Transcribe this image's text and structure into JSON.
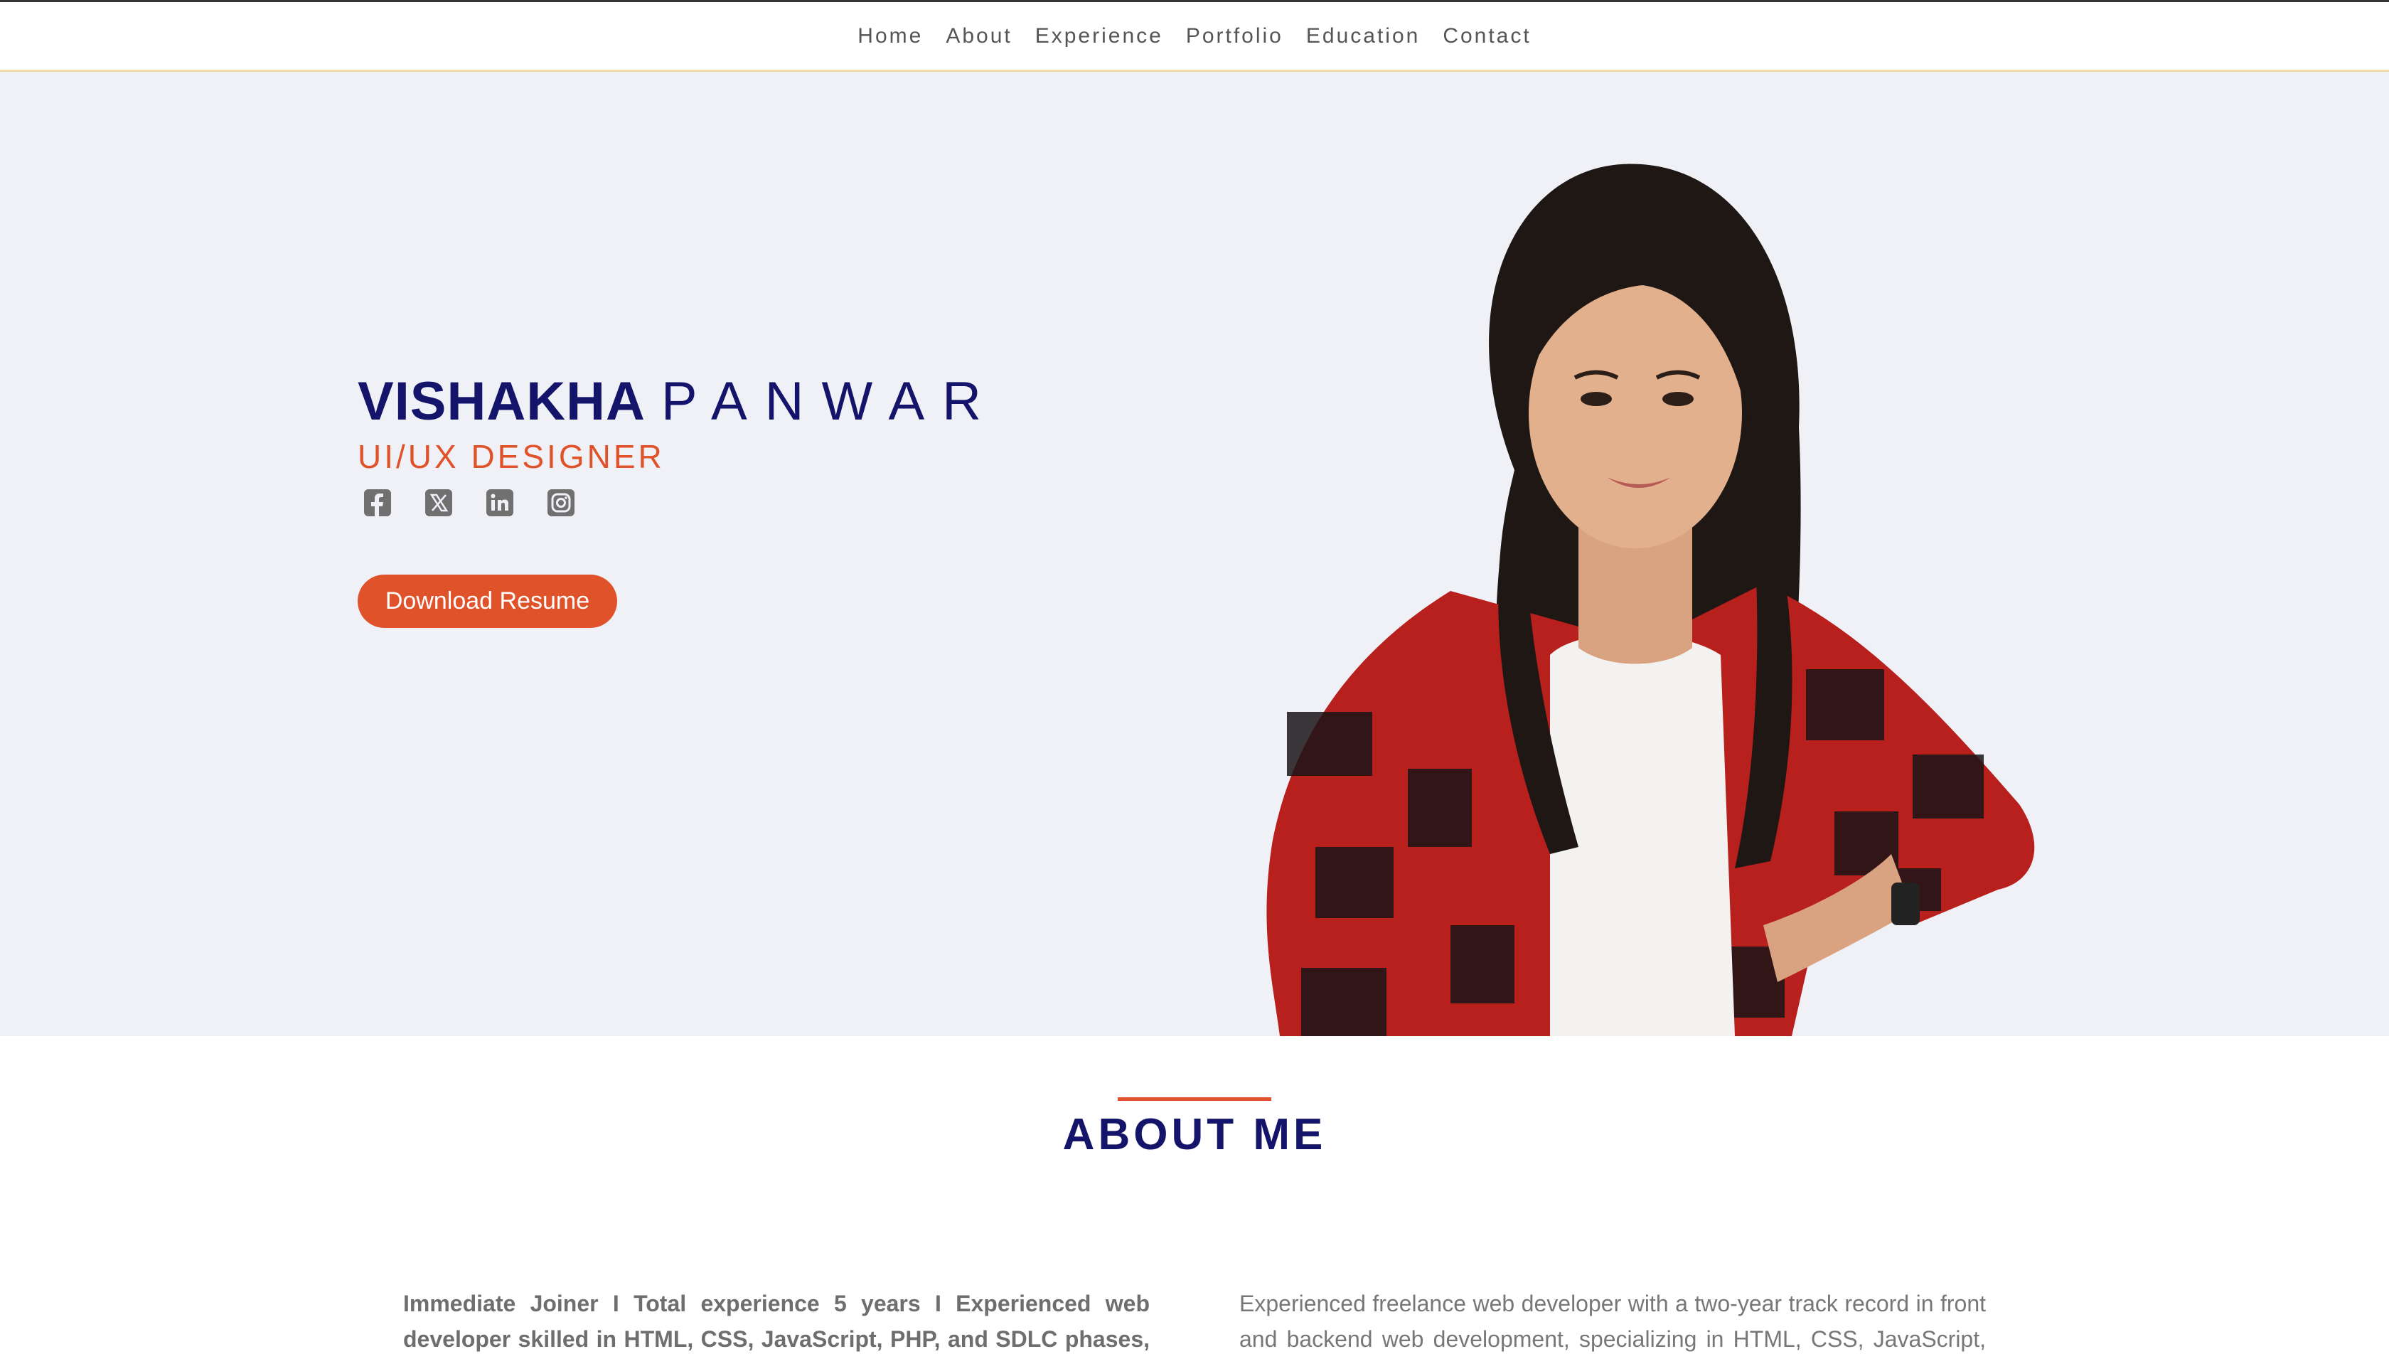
{
  "nav": {
    "items": [
      "Home",
      "About",
      "Experience",
      "Portfolio",
      "Education",
      "Contact"
    ]
  },
  "hero": {
    "first_name": "VISHAKHA",
    "last_name": "PANWAR",
    "title": "UI/UX DESIGNER",
    "socials": [
      "facebook-icon",
      "x-twitter-icon",
      "linkedin-icon",
      "instagram-icon"
    ],
    "resume_button": "Download Resume"
  },
  "about": {
    "heading": "ABOUT ME",
    "left_line1": "Immediate Joiner I Total experience 5 years I Experienced web",
    "left_line2": "developer skilled in HTML, CSS, JavaScript, PHP, and SDLC phases,",
    "right_line1": "Experienced freelance web developer with a two-year track record in front",
    "right_line2": "and backend web development, specializing in HTML, CSS, JavaScript,"
  },
  "colors": {
    "accent": "#e0522a",
    "navy": "#14146a",
    "hero_bg": "#f0f1f7"
  }
}
